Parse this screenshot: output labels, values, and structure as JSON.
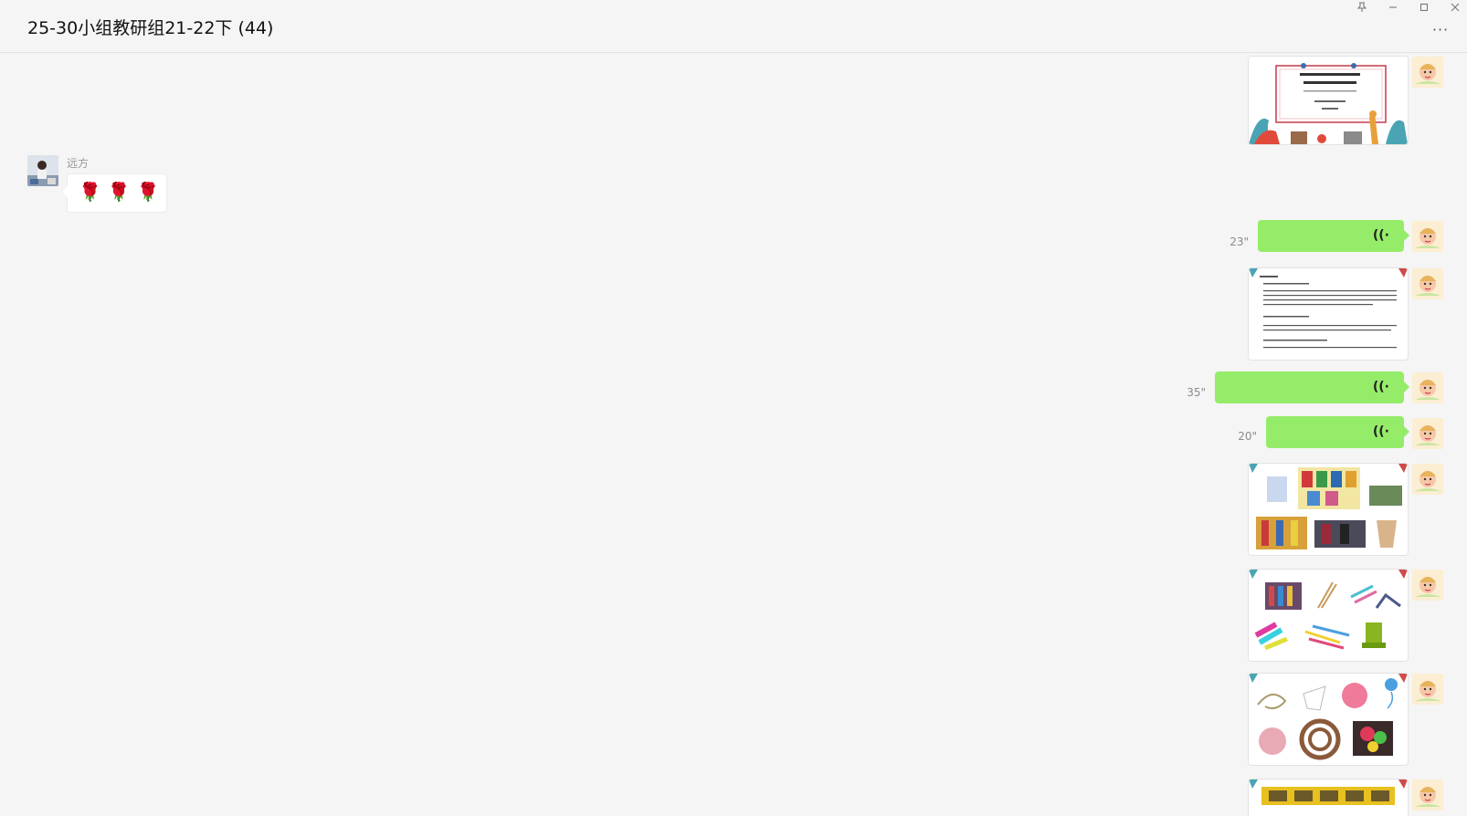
{
  "header": {
    "title": "25-30小组教研组21-22下 (44)",
    "pin_icon": "pin-icon",
    "minimize_icon": "minimize-icon",
    "maximize_icon": "maximize-icon",
    "close_icon": "close-icon",
    "more_label": "···"
  },
  "messages": {
    "incoming": {
      "sender": "远方",
      "text": "🌹🌹🌹"
    },
    "voice": [
      {
        "duration": "23\""
      },
      {
        "duration": "35\""
      },
      {
        "duration": "20\""
      }
    ],
    "images": [
      {
        "kind": "title-slide"
      },
      {
        "kind": "text-document"
      },
      {
        "kind": "materials-photos"
      },
      {
        "kind": "clips-and-tools"
      },
      {
        "kind": "yarn-and-rope"
      },
      {
        "kind": "banner-slide"
      }
    ]
  },
  "colors": {
    "voice_bubble": "#95ec69",
    "background": "#f5f5f5"
  }
}
